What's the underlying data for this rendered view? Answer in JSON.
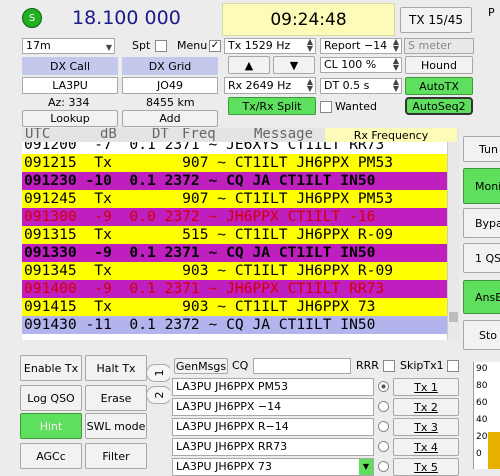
{
  "top": {
    "frequency": "18.100 000",
    "time": "09:24:48",
    "tx_period": "TX 15/45",
    "partial_title": "P",
    "status_icon": "S"
  },
  "controls": {
    "band": "17m",
    "spt_label": "Spt",
    "menu_label": "Menu",
    "tx_freq": "Tx  1529  Hz",
    "report": "Report −14",
    "s_meter": "S meter",
    "dx_call_label": "DX Call",
    "dx_grid_label": "DX Grid",
    "dx_call": "LA3PU",
    "dx_grid": "JO49",
    "az": "Az: 334",
    "dist": "8455 km",
    "lookup": "Lookup",
    "add": "Add",
    "cl": "CL  100 %",
    "hound": "Hound",
    "rx_freq": "Rx  2649  Hz",
    "autotx": "AutoTX",
    "txrx_split": "Tx/Rx Split",
    "dt": "DT  0.5 s",
    "wanted": "Wanted",
    "autoseq": "AutoSeq2"
  },
  "decode": {
    "headers": [
      "UTC",
      "dB",
      "DT",
      "Freq",
      "Message"
    ],
    "rx_frequency_label": "Rx Frequency",
    "rows": [
      {
        "text": "091200  -7  0.1 2371 ~ JE6XYS CT1ILT RR73",
        "bg": "#ffffff",
        "fg": "#000000",
        "bold": false
      },
      {
        "text": "091215  Tx        907 ~ CT1ILT JH6PPX PM53",
        "bg": "#ffff00",
        "fg": "#000000",
        "bold": false
      },
      {
        "text": "091230 -10  0.1 2372 ~ CQ JA CT1ILT IN50",
        "bg": "#bf1fbf",
        "fg": "#000000",
        "bold": true
      },
      {
        "text": "091245  Tx        907 ~ CT1ILT JH6PPX PM53",
        "bg": "#ffff00",
        "fg": "#000000",
        "bold": false
      },
      {
        "text": "091300  -9  0.0 2372 ~ JH6PPX CT1ILT -16",
        "bg": "#bf1fbf",
        "fg": "#d40000",
        "bold": false
      },
      {
        "text": "091315  Tx        515 ~ CT1ILT JH6PPX R-09",
        "bg": "#ffff00",
        "fg": "#000000",
        "bold": false
      },
      {
        "text": "091330  -9  0.1 2371 ~ CQ JA CT1ILT IN50",
        "bg": "#bf1fbf",
        "fg": "#000000",
        "bold": true
      },
      {
        "text": "091345  Tx        903 ~ CT1ILT JH6PPX R-09",
        "bg": "#ffff00",
        "fg": "#000000",
        "bold": false
      },
      {
        "text": "091400  -9  0.1 2371 ~ JH6PPX CT1ILT RR73",
        "bg": "#bf1fbf",
        "fg": "#d40000",
        "bold": false
      },
      {
        "text": "091415  Tx        903 ~ CT1ILT JH6PPX 73",
        "bg": "#ffff00",
        "fg": "#000000",
        "bold": false
      },
      {
        "text": "091430 -11  0.1 2372 ~ CQ JA CT1ILT IN50",
        "bg": "#b3b3ee",
        "fg": "#000000",
        "bold": false
      }
    ]
  },
  "right_buttons": [
    "Tun",
    "Moni",
    "Bypa",
    "1 QS",
    "AnsE",
    "Sto"
  ],
  "left_buttons": {
    "enable_tx": "Enable Tx",
    "halt_tx": "Halt Tx",
    "log_qso": "Log QSO",
    "erase": "Erase",
    "hint": "Hint",
    "swl_mode": "SWL mode",
    "agcc": "AGCc",
    "filter": "Filter"
  },
  "tabs": {
    "tab1": "1",
    "tab2": "2"
  },
  "msgs": {
    "genmsgs": "GenMsgs",
    "cq_label": "CQ",
    "rrr_label": "RRR",
    "skiptx1_label": "SkipTx1",
    "tx1": "LA3PU JH6PPX PM53",
    "tx2": "LA3PU JH6PPX −14",
    "tx3": "LA3PU JH6PPX R−14",
    "tx4": "LA3PU JH6PPX RR73",
    "tx5": "LA3PU JH6PPX 73",
    "tx1_btn": "Tx 1",
    "tx2_btn": "Tx 2",
    "tx3_btn": "Tx 3",
    "tx4_btn": "Tx 4",
    "tx5_btn": "Tx 5"
  },
  "meter": {
    "ticks": [
      "90",
      "80",
      "60",
      "40",
      "20",
      "0"
    ],
    "level_percent": 35
  }
}
